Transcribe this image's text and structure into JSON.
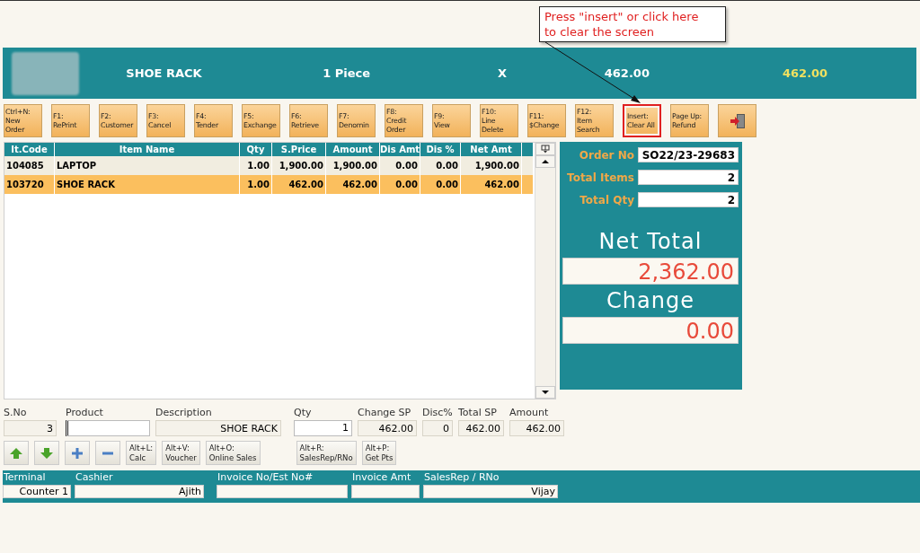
{
  "callout": {
    "text": "Press \"insert\" or click here\nto clear the screen"
  },
  "banner": {
    "item": "SHOE RACK",
    "quantity": "1 Piece",
    "multiplier": "X",
    "price": "462.00",
    "total": "462.00"
  },
  "toolbar": [
    {
      "kind": "text",
      "label": "Ctrl+N:\nNew\nOrder",
      "highlighted": false
    },
    {
      "kind": "text",
      "label": "F1:\nRePrint",
      "highlighted": false
    },
    {
      "kind": "text",
      "label": "F2:\nCustomer",
      "highlighted": false
    },
    {
      "kind": "text",
      "label": "F3:\nCancel",
      "highlighted": false
    },
    {
      "kind": "text",
      "label": "F4:\nTender",
      "highlighted": false
    },
    {
      "kind": "text",
      "label": "F5:\nExchange",
      "highlighted": false
    },
    {
      "kind": "text",
      "label": "F6:\nRetrieve",
      "highlighted": false
    },
    {
      "kind": "text",
      "label": "F7:\nDenomin",
      "highlighted": false
    },
    {
      "kind": "text",
      "label": "F8:\nCredit\nOrder",
      "highlighted": false
    },
    {
      "kind": "text",
      "label": "F9:\nView",
      "highlighted": false
    },
    {
      "kind": "text",
      "label": "F10:\nLine\nDelete",
      "highlighted": false
    },
    {
      "kind": "text",
      "label": "F11:\n$Change",
      "highlighted": false
    },
    {
      "kind": "text",
      "label": "F12:\nItem\nSearch",
      "highlighted": false
    },
    {
      "kind": "text",
      "label": "Insert:\nClear All",
      "highlighted": true
    },
    {
      "kind": "text",
      "label": "Page Up:\nRefund",
      "highlighted": false
    },
    {
      "kind": "exit",
      "highlighted": false
    }
  ],
  "table": {
    "columns": [
      "It.Code",
      "Item Name",
      "Qty",
      "S.Price",
      "Amount",
      "Dis Amt",
      "Dis %",
      "Net Amt"
    ],
    "rows": [
      {
        "cells": [
          "104085",
          "LAPTOP",
          "1.00",
          "1,900.00",
          "1,900.00",
          "0.00",
          "0.00",
          "1,900.00"
        ],
        "selected": false
      },
      {
        "cells": [
          "103720",
          "SHOE RACK",
          "1.00",
          "462.00",
          "462.00",
          "0.00",
          "0.00",
          "462.00"
        ],
        "selected": true
      }
    ]
  },
  "summary": {
    "fields": [
      {
        "label": "Order No",
        "value": "SO22/23-29683"
      },
      {
        "label": "Total Items",
        "value": "2"
      },
      {
        "label": "Total Qty",
        "value": "2"
      }
    ],
    "net_total_label": "Net Total",
    "net_total": "2,362.00",
    "change_label": "Change",
    "change": "0.00"
  },
  "entry": {
    "fields": [
      {
        "label": "S.No",
        "value": "3",
        "kind": "readonly"
      },
      {
        "label": "Product",
        "kind": "input"
      },
      {
        "label": "Description",
        "value": "SHOE RACK",
        "kind": "readonly"
      },
      {
        "label": "Qty",
        "value": "1",
        "kind": "input"
      },
      {
        "label": "Change SP",
        "value": "462.00",
        "kind": "readonly"
      },
      {
        "label": "Disc%",
        "value": "0",
        "kind": "readonly"
      },
      {
        "label": "Total SP",
        "value": "462.00",
        "kind": "readonly"
      },
      {
        "label": "Amount",
        "value": "462.00",
        "kind": "readonly"
      }
    ]
  },
  "actions": [
    {
      "kind": "up"
    },
    {
      "kind": "down"
    },
    {
      "kind": "plus"
    },
    {
      "kind": "minus"
    },
    {
      "kind": "text",
      "label": "Alt+L:\nCalc"
    },
    {
      "kind": "text",
      "label": "Alt+V:\nVoucher"
    },
    {
      "kind": "text",
      "label": "Alt+O:\nOnline Sales"
    },
    {
      "kind": "text",
      "label": "Alt+R:\nSalesRep/RNo"
    },
    {
      "kind": "text",
      "label": "Alt+P:\nGet Pts"
    }
  ],
  "status_bar": [
    {
      "label": "Terminal",
      "value": "Counter 1"
    },
    {
      "label": "Cashier",
      "value": "Ajith"
    },
    {
      "label": "Invoice No/Est No#"
    },
    {
      "label": "Invoice Amt"
    },
    {
      "label": "SalesRep / RNo",
      "value": "Vijay"
    }
  ]
}
